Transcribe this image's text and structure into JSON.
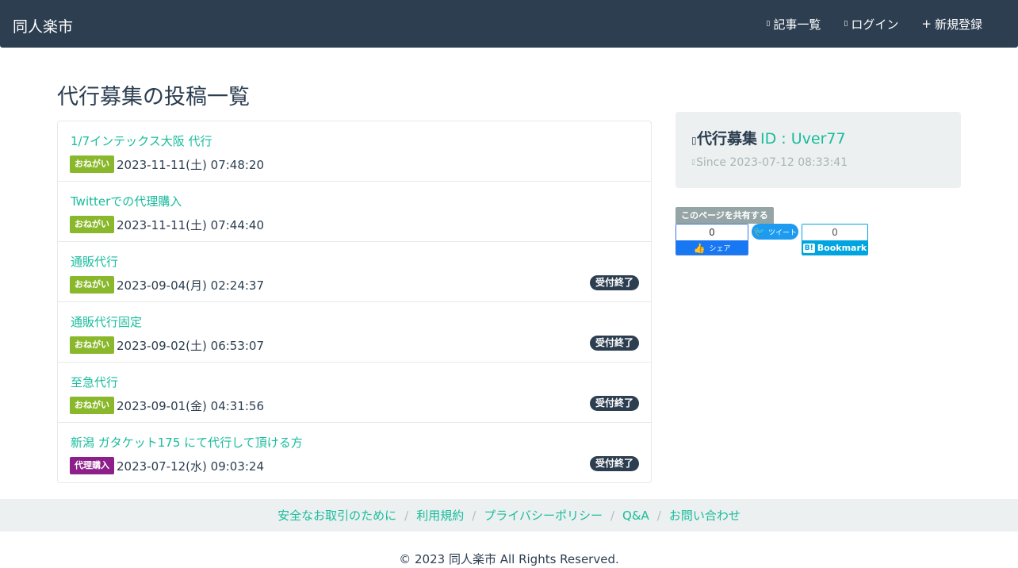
{
  "navbar": {
    "brand": "同人楽市",
    "links": [
      {
        "icon": "list-icon",
        "label": "記事一覧"
      },
      {
        "icon": "login-icon",
        "label": "ログイン"
      },
      {
        "icon": "plus-icon",
        "glyph": "+",
        "label": "新規登録"
      }
    ]
  },
  "page_title": "代行募集の投稿一覧",
  "posts": [
    {
      "title": "1/7インテックス大阪 代行",
      "tag": "おねがい",
      "date": "2023-11-11(土) 07:48:20",
      "status": ""
    },
    {
      "title": "Twitterでの代理購入",
      "tag": "おねがい",
      "date": "2023-11-11(土) 07:44:40",
      "status": ""
    },
    {
      "title": "通販代行",
      "tag": "おねがい",
      "date": "2023-09-04(月) 02:24:37",
      "status": "受付終了"
    },
    {
      "title": "通販代行固定",
      "tag": "おねがい",
      "date": "2023-09-02(土) 06:53:07",
      "status": "受付終了"
    },
    {
      "title": "至急代行",
      "tag": "おねがい",
      "date": "2023-09-01(金) 04:31:56",
      "status": "受付終了"
    },
    {
      "title": "新潟 ガタケット175 にて代行して頂ける方",
      "tag": "代理購入",
      "date": "2023-07-12(水) 09:03:24",
      "status": "受付終了"
    }
  ],
  "profile": {
    "name": "代行募集",
    "id": "ID : Uver77",
    "since": "Since 2023-07-12 08:33:41"
  },
  "share": {
    "label": "このページを共有する",
    "facebook_count": "0",
    "facebook_label": "シェア",
    "twitter_label": "ツイート",
    "hatena_count": "0",
    "hatena_label": "Bookmark",
    "hatena_mark": "B!"
  },
  "footer": {
    "links": [
      "安全なお取引のために",
      "利用規約",
      "プライバシーポリシー",
      "Q&A",
      "お問い合わせ"
    ],
    "separator": "/",
    "copyright": "© 2023 同人楽市 All Rights Reserved."
  },
  "colors": {
    "navbar_bg": "#2c3e50",
    "accent": "#18bc9c",
    "tag_onegai": "#8ab82c",
    "tag_dairi": "#8d1f8a",
    "badge_closed": "#2c3e50"
  }
}
